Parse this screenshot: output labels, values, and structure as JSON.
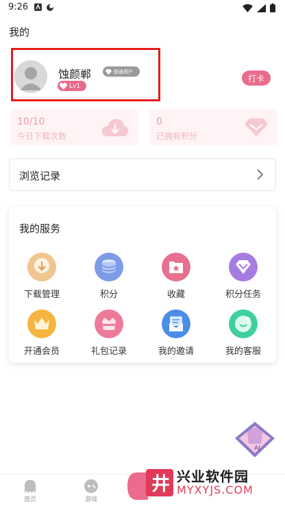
{
  "status_bar": {
    "time": "9:26"
  },
  "page_title": "我的",
  "profile": {
    "username": "蚀颜郸",
    "member_badge": "普通用户",
    "level": "Lv1",
    "checkin_label": "打卡"
  },
  "stats": [
    {
      "value": "10/10",
      "label": "今日下载次数",
      "icon": "cloud-download-icon"
    },
    {
      "value": "0",
      "label": "已拥有积分",
      "icon": "diamond-icon"
    }
  ],
  "history": {
    "label": "浏览记录"
  },
  "services": {
    "title": "我的服务",
    "items": [
      {
        "label": "下载管理",
        "icon": "download-manage-icon",
        "color": "#f0c27a"
      },
      {
        "label": "积分",
        "icon": "points-stack-icon",
        "color": "#6b8fe0"
      },
      {
        "label": "收藏",
        "icon": "favorite-folder-icon",
        "color": "#e86a90"
      },
      {
        "label": "积分任务",
        "icon": "points-task-icon",
        "color": "#a77ce0"
      },
      {
        "label": "开通会员",
        "icon": "crown-icon",
        "color": "#f5b540"
      },
      {
        "label": "礼包记录",
        "icon": "gift-icon",
        "color": "#ee7a9a"
      },
      {
        "label": "我的邀请",
        "icon": "invite-icon",
        "color": "#4a8ee8"
      },
      {
        "label": "我的客服",
        "icon": "customer-service-icon",
        "color": "#3fcf9e"
      }
    ]
  },
  "bottom_nav": [
    {
      "label": "首页",
      "icon": "ghost-home-icon"
    },
    {
      "label": "游戏",
      "icon": "gamepad-icon"
    }
  ],
  "watermark": {
    "title": "兴业软件园",
    "url": "MYXYJS.COM",
    "logo_char": "井"
  },
  "floating_ai": {
    "label": "AI"
  }
}
